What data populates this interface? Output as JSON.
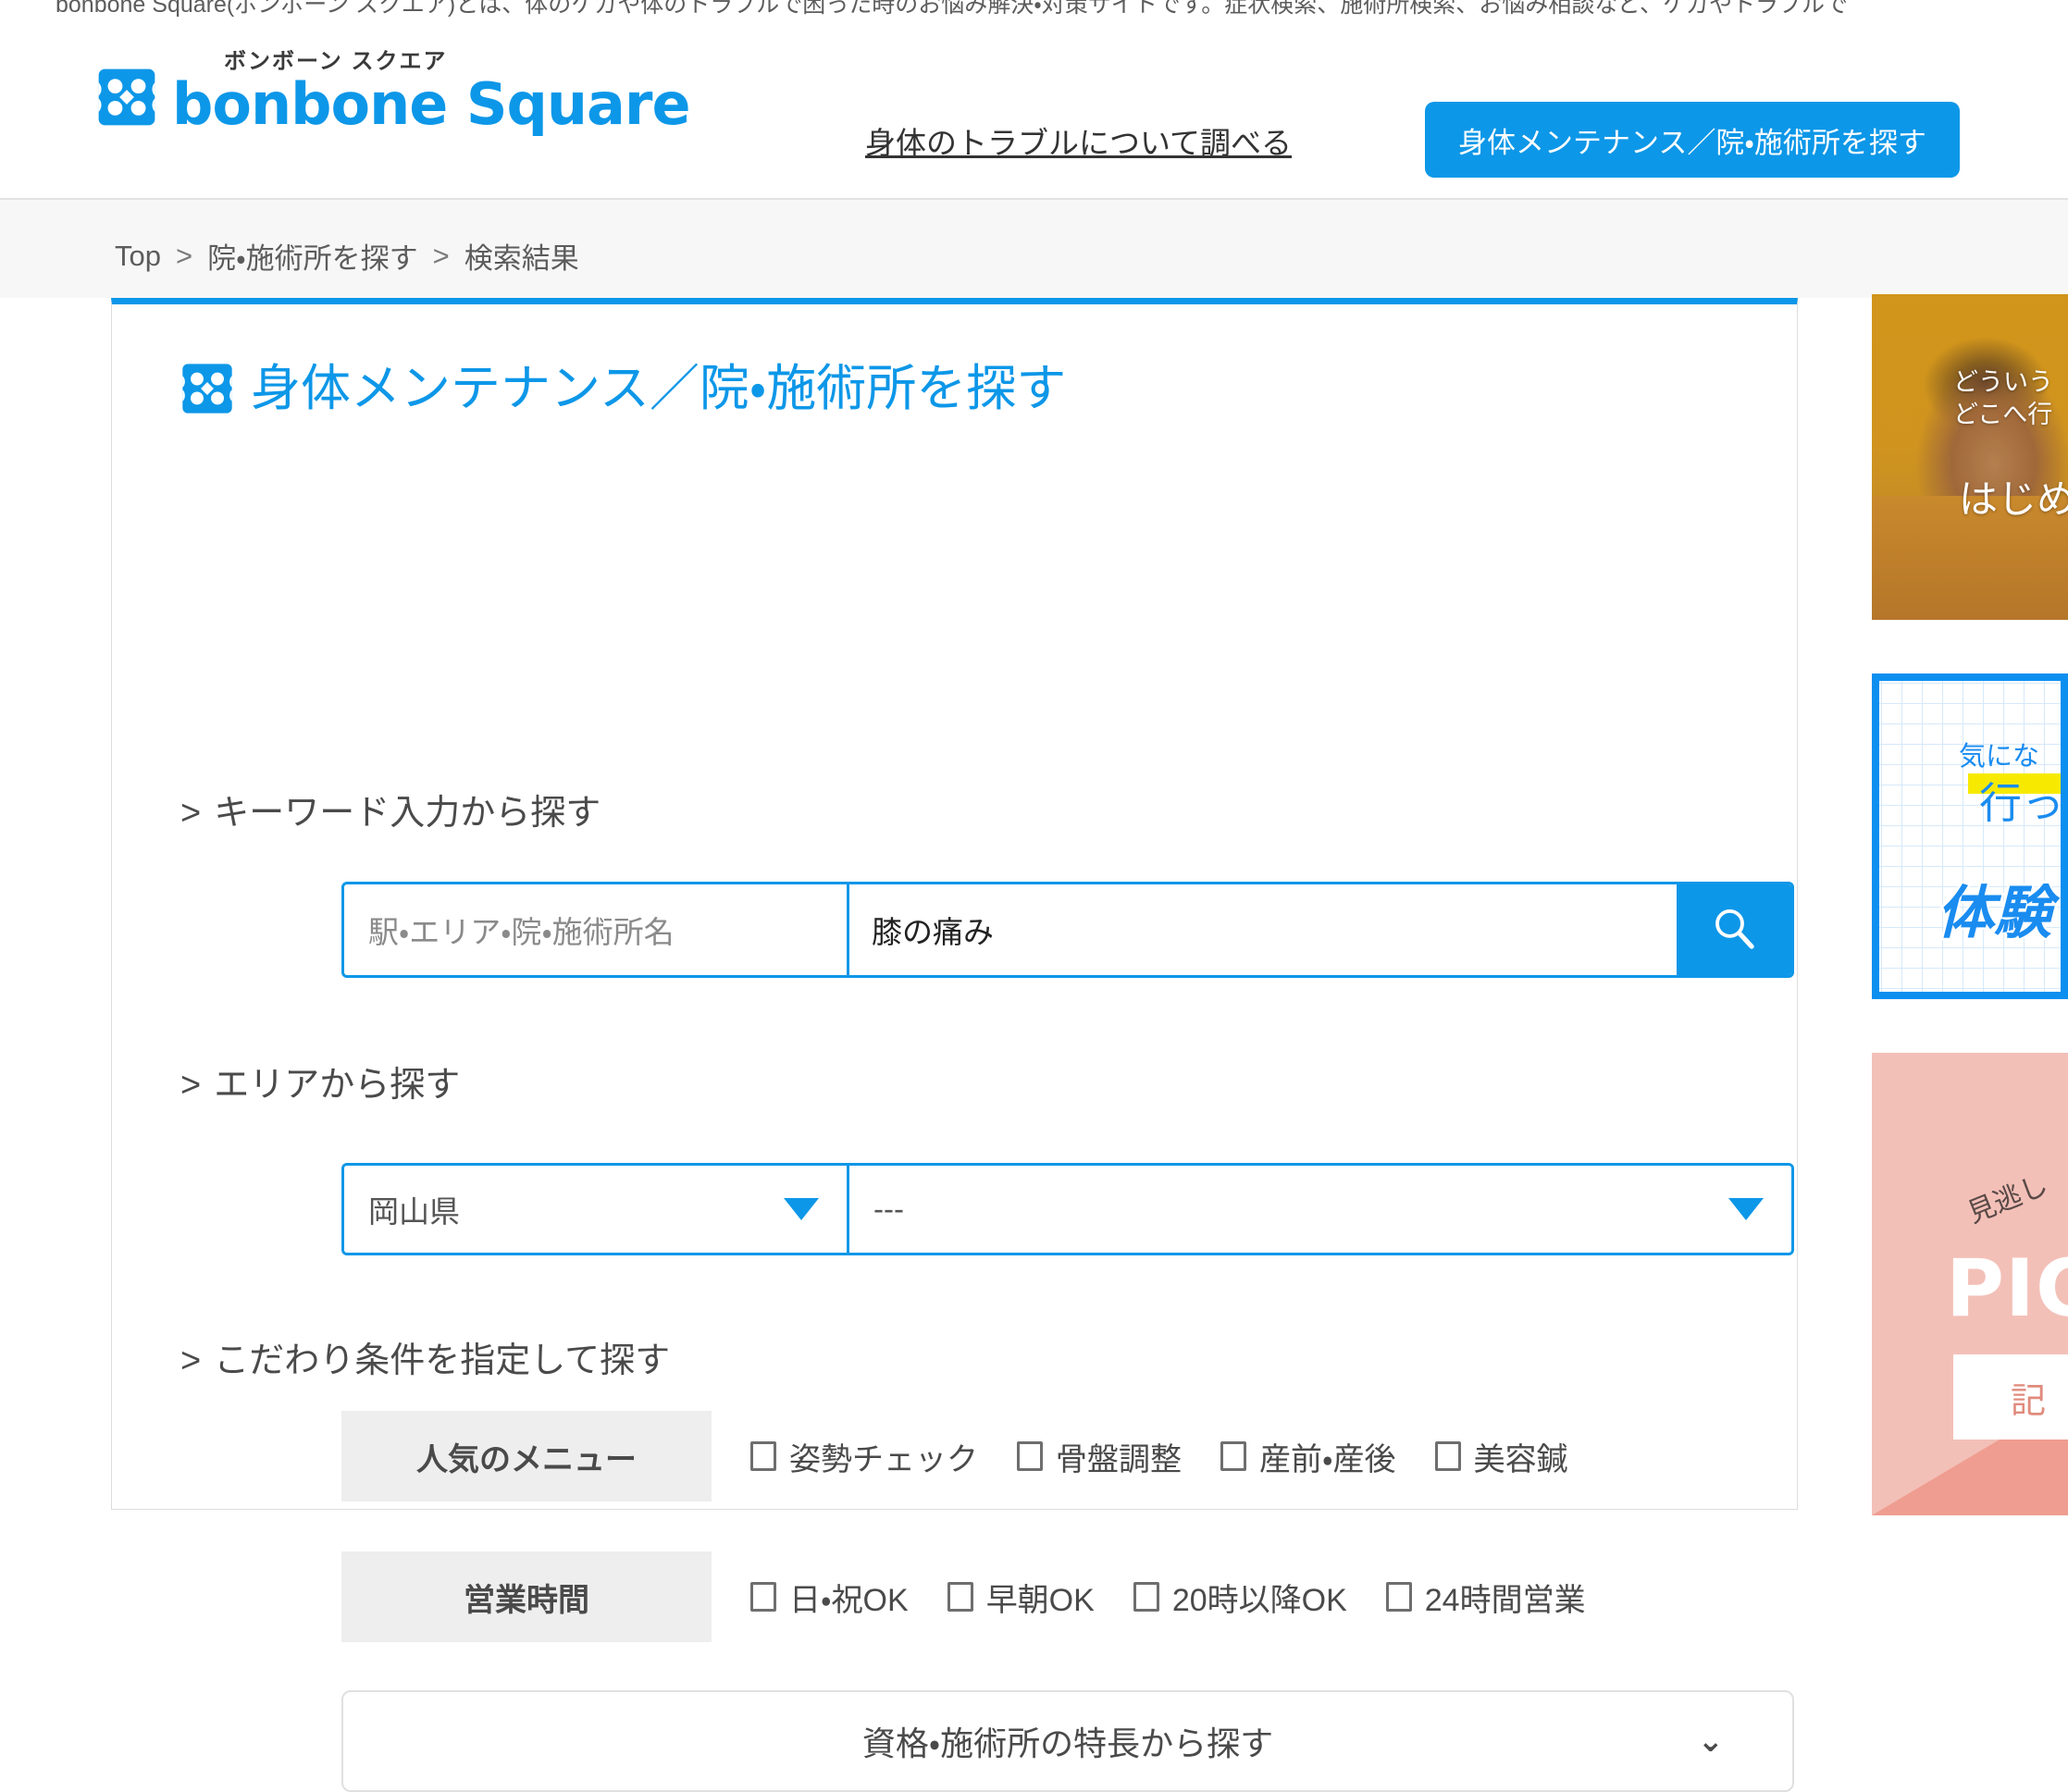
{
  "top_notice": "bonbone Square(ボンボーン スクエア)とは、体のケガや体のトラブルで困った時のお悩み解決・対策サイトです。症状検索、施術所検索、お悩み相談など、ケガやトラブルで",
  "header": {
    "logo_kana": "ボンボーン スクエア",
    "logo_word": "bonbone Square",
    "nav_link": "身体のトラブルについて調べる",
    "cta_label": "身体メンテナンス／院・施術所を探す",
    "accent_color": "#0d97e8"
  },
  "breadcrumb": {
    "items": [
      "Top",
      "院・施術所を探す",
      "検索結果"
    ],
    "separator": ">"
  },
  "panel": {
    "title": "身体メンテナンス／院・施術所を探す",
    "sections": {
      "keyword": "キーワード入力から探す",
      "area": "エリアから探す",
      "conditions": "こだわり条件を指定して探す"
    },
    "chevron": ">"
  },
  "keyword_search": {
    "field_label": "駅・エリア・院・施術所名",
    "placeholder": "駅・エリア・院・施術所名",
    "value": "膝の痛み",
    "search_icon": "search-icon"
  },
  "area_search": {
    "prefecture_value": "岡山県",
    "city_value": "---"
  },
  "conditions": [
    {
      "label": "人気のメニュー",
      "options": [
        "姿勢チェック",
        "骨盤調整",
        "産前・産後",
        "美容鍼"
      ]
    },
    {
      "label": "営業時間",
      "options": [
        "日・祝OK",
        "早朝OK",
        "20時以降OK",
        "24時間営業"
      ]
    }
  ],
  "accordion": {
    "label": "資格・施術所の特長から探す",
    "chevron": "⌄"
  },
  "rail": {
    "banner_photo": {
      "line1": "どういう",
      "line2": "どこへ行",
      "line3": "はじめ"
    },
    "banner_grid": {
      "line1": "気にな",
      "line2": "行っ",
      "line3": "体験"
    },
    "banner_pink": {
      "rotated": "見逃し",
      "headline": "PIC",
      "button": "記"
    }
  }
}
